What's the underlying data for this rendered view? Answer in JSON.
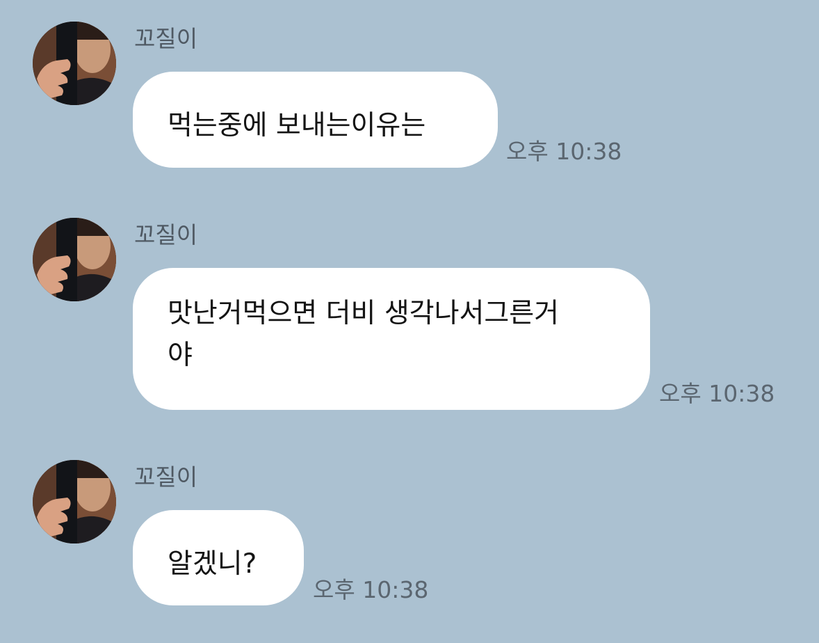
{
  "chat": {
    "messages": [
      {
        "sender": "꼬질이",
        "lines": [
          "먹는중에 보내는이유는"
        ],
        "time": "오후 10:38"
      },
      {
        "sender": "꼬질이",
        "lines": [
          "맛난거먹으면 더비 생각나서그른거",
          "야"
        ],
        "time": "오후 10:38"
      },
      {
        "sender": "꼬질이",
        "lines": [
          "알겠니?"
        ],
        "time": "오후 10:38"
      }
    ]
  },
  "colors": {
    "background": "#abc1d1",
    "bubble": "#ffffff",
    "sender_text": "#4f5963",
    "time_text": "#5b6670"
  },
  "icons": {
    "avatar": "profile-photo"
  }
}
